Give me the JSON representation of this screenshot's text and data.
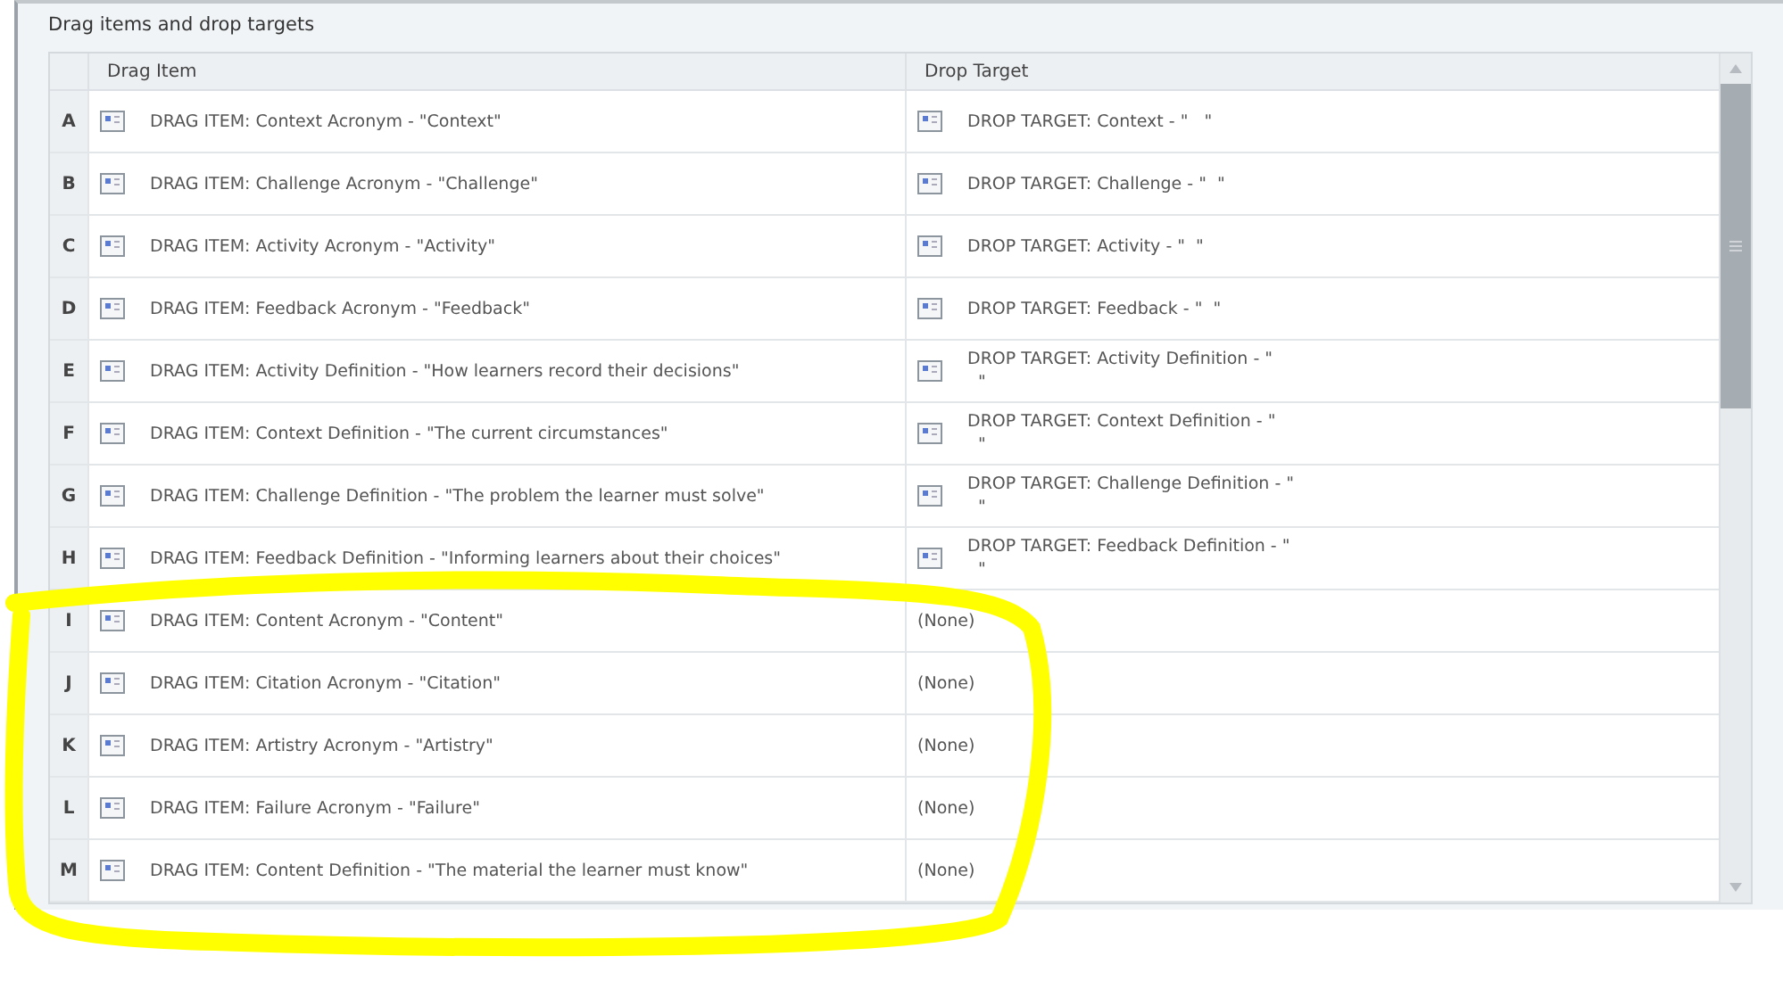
{
  "panel": {
    "title": "Drag items and drop targets"
  },
  "table": {
    "columns": [
      "Drag Item",
      "Drop Target"
    ],
    "rows": [
      {
        "letter": "A",
        "drag_item": "DRAG ITEM: Context Acronym - \"Context\"",
        "drop_target": "DROP TARGET: Context - \"   \"",
        "target_icon": true
      },
      {
        "letter": "B",
        "drag_item": "DRAG ITEM: Challenge Acronym - \"Challenge\"",
        "drop_target": "DROP TARGET: Challenge - \"  \"",
        "target_icon": true
      },
      {
        "letter": "C",
        "drag_item": "DRAG ITEM: Activity Acronym - \"Activity\"",
        "drop_target": "DROP TARGET: Activity - \"  \"",
        "target_icon": true
      },
      {
        "letter": "D",
        "drag_item": "DRAG ITEM: Feedback Acronym - \"Feedback\"",
        "drop_target": "DROP TARGET: Feedback - \"  \"",
        "target_icon": true
      },
      {
        "letter": "E",
        "drag_item": "DRAG ITEM: Activity Definition - \"How learners record their decisions\"",
        "drop_target": "DROP TARGET: Activity Definition - \"\n  \"",
        "target_icon": true
      },
      {
        "letter": "F",
        "drag_item": "DRAG ITEM: Context Definition - \"The current circumstances\"",
        "drop_target": "DROP TARGET: Context Definition - \"\n  \"",
        "target_icon": true
      },
      {
        "letter": "G",
        "drag_item": "DRAG ITEM: Challenge Definition - \"The problem the learner must solve\"",
        "drop_target": "DROP TARGET: Challenge Definition - \"\n  \"",
        "target_icon": true
      },
      {
        "letter": "H",
        "drag_item": "DRAG ITEM: Feedback Definition - \"Informing learners about their choices\"",
        "drop_target": "DROP TARGET: Feedback Definition - \"\n  \"",
        "target_icon": true
      },
      {
        "letter": "I",
        "drag_item": "DRAG ITEM: Content Acronym - \"Content\"",
        "drop_target": "(None)",
        "target_icon": false
      },
      {
        "letter": "J",
        "drag_item": "DRAG ITEM: Citation Acronym - \"Citation\"",
        "drop_target": "(None)",
        "target_icon": false
      },
      {
        "letter": "K",
        "drag_item": "DRAG ITEM: Artistry Acronym - \"Artistry\"",
        "drop_target": "(None)",
        "target_icon": false
      },
      {
        "letter": "L",
        "drag_item": "DRAG ITEM: Failure Acronym - \"Failure\"",
        "drop_target": "(None)",
        "target_icon": false
      },
      {
        "letter": "M",
        "drag_item": "DRAG ITEM: Content Definition - \"The material the learner must know\"",
        "drop_target": "(None)",
        "target_icon": false
      }
    ]
  }
}
